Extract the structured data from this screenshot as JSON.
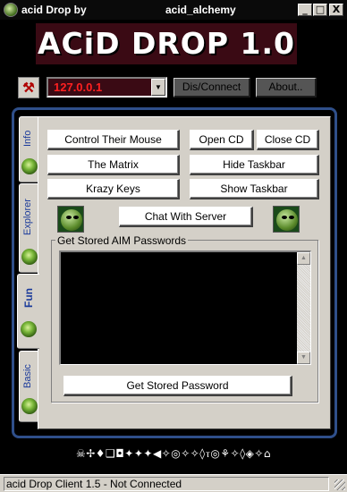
{
  "window": {
    "title_left": "acid Drop  by",
    "title_right": "acid_alchemy",
    "controls": {
      "minimize": "_",
      "maximize": "□",
      "close": "X"
    }
  },
  "logo": {
    "text": "ACiD DROP 1.0"
  },
  "connection": {
    "server_value": "127.0.0.1",
    "dropdown_icon": "chevron-down-icon",
    "connect_label": "Dis/Connect",
    "about_label": "About.."
  },
  "tabs": [
    {
      "label": "Info",
      "active": false
    },
    {
      "label": "Explorer",
      "active": false
    },
    {
      "label": "Fun",
      "active": true
    },
    {
      "label": "Basic",
      "active": false
    }
  ],
  "fun": {
    "control_mouse": "Control Their Mouse",
    "open_cd": "Open CD",
    "close_cd": "Close CD",
    "matrix": "The Matrix",
    "hide_taskbar": "Hide Taskbar",
    "krazy_keys": "Krazy Keys",
    "show_taskbar": "Show Taskbar",
    "chat": "Chat With Server",
    "aim_group_title": "Get Stored AIM Passwords",
    "get_password": "Get Stored Password"
  },
  "symbol_string": "☠✢♦❑◘✦✦✦◀✧◎✧✧◊ⲧ◎⚘✧◊◈✧⌂",
  "status": {
    "text": "acid Drop Client 1.5 - Not Connected"
  },
  "colors": {
    "frame": "#2f4f8a",
    "ip_text": "#ff2020",
    "tab_text": "#1a3a9a"
  }
}
